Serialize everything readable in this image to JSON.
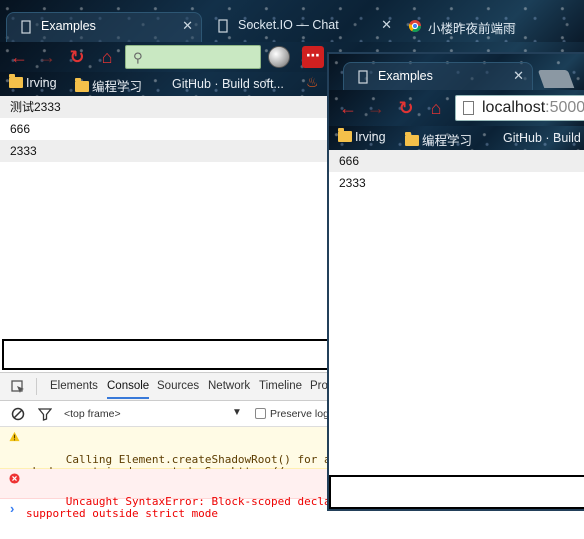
{
  "window_back": {
    "tabs": [
      {
        "label": "Examples",
        "active": true
      },
      {
        "label": "Socket.IO — Chat",
        "active": false
      },
      {
        "label": "小楼昨夜前端雨",
        "active": false
      }
    ],
    "bookmarks": [
      {
        "label": "Irving",
        "icon": "folder-icon"
      },
      {
        "label": "编程学习",
        "icon": "folder-icon"
      },
      {
        "label": "GitHub · Build soft...",
        "icon": "github-icon"
      }
    ],
    "messages": [
      "测试2333",
      "666",
      "2333"
    ],
    "devtools": {
      "tabs": [
        "Elements",
        "Console",
        "Sources",
        "Network",
        "Timeline",
        "Pro"
      ],
      "selected_tab": "Console",
      "context": "<top frame>",
      "preserve_log": "Preserve log",
      "warning": "Calling Element.createShadowRoot() for an e\nshadow root is deprecated. See https://www.\ndetails.",
      "error": "Uncaught SyntaxError: Block-scoped declarat\nsupported outside strict mode",
      "prompt": "›"
    }
  },
  "window_front": {
    "tabs": [
      {
        "label": "Examples",
        "active": true
      }
    ],
    "address": {
      "host": "localhost",
      "port": ":5000"
    },
    "bookmarks": [
      {
        "label": "Irving",
        "icon": "folder-icon"
      },
      {
        "label": "编程学习",
        "icon": "folder-icon"
      },
      {
        "label": "GitHub · Build",
        "icon": "github-icon"
      }
    ],
    "messages": [
      "666",
      "2333"
    ]
  },
  "colors": {
    "accent": "#3879d9",
    "nav_red": "#e03434",
    "omnibox_green": "#c9e8c2",
    "row_alt": "#eeeeee"
  }
}
